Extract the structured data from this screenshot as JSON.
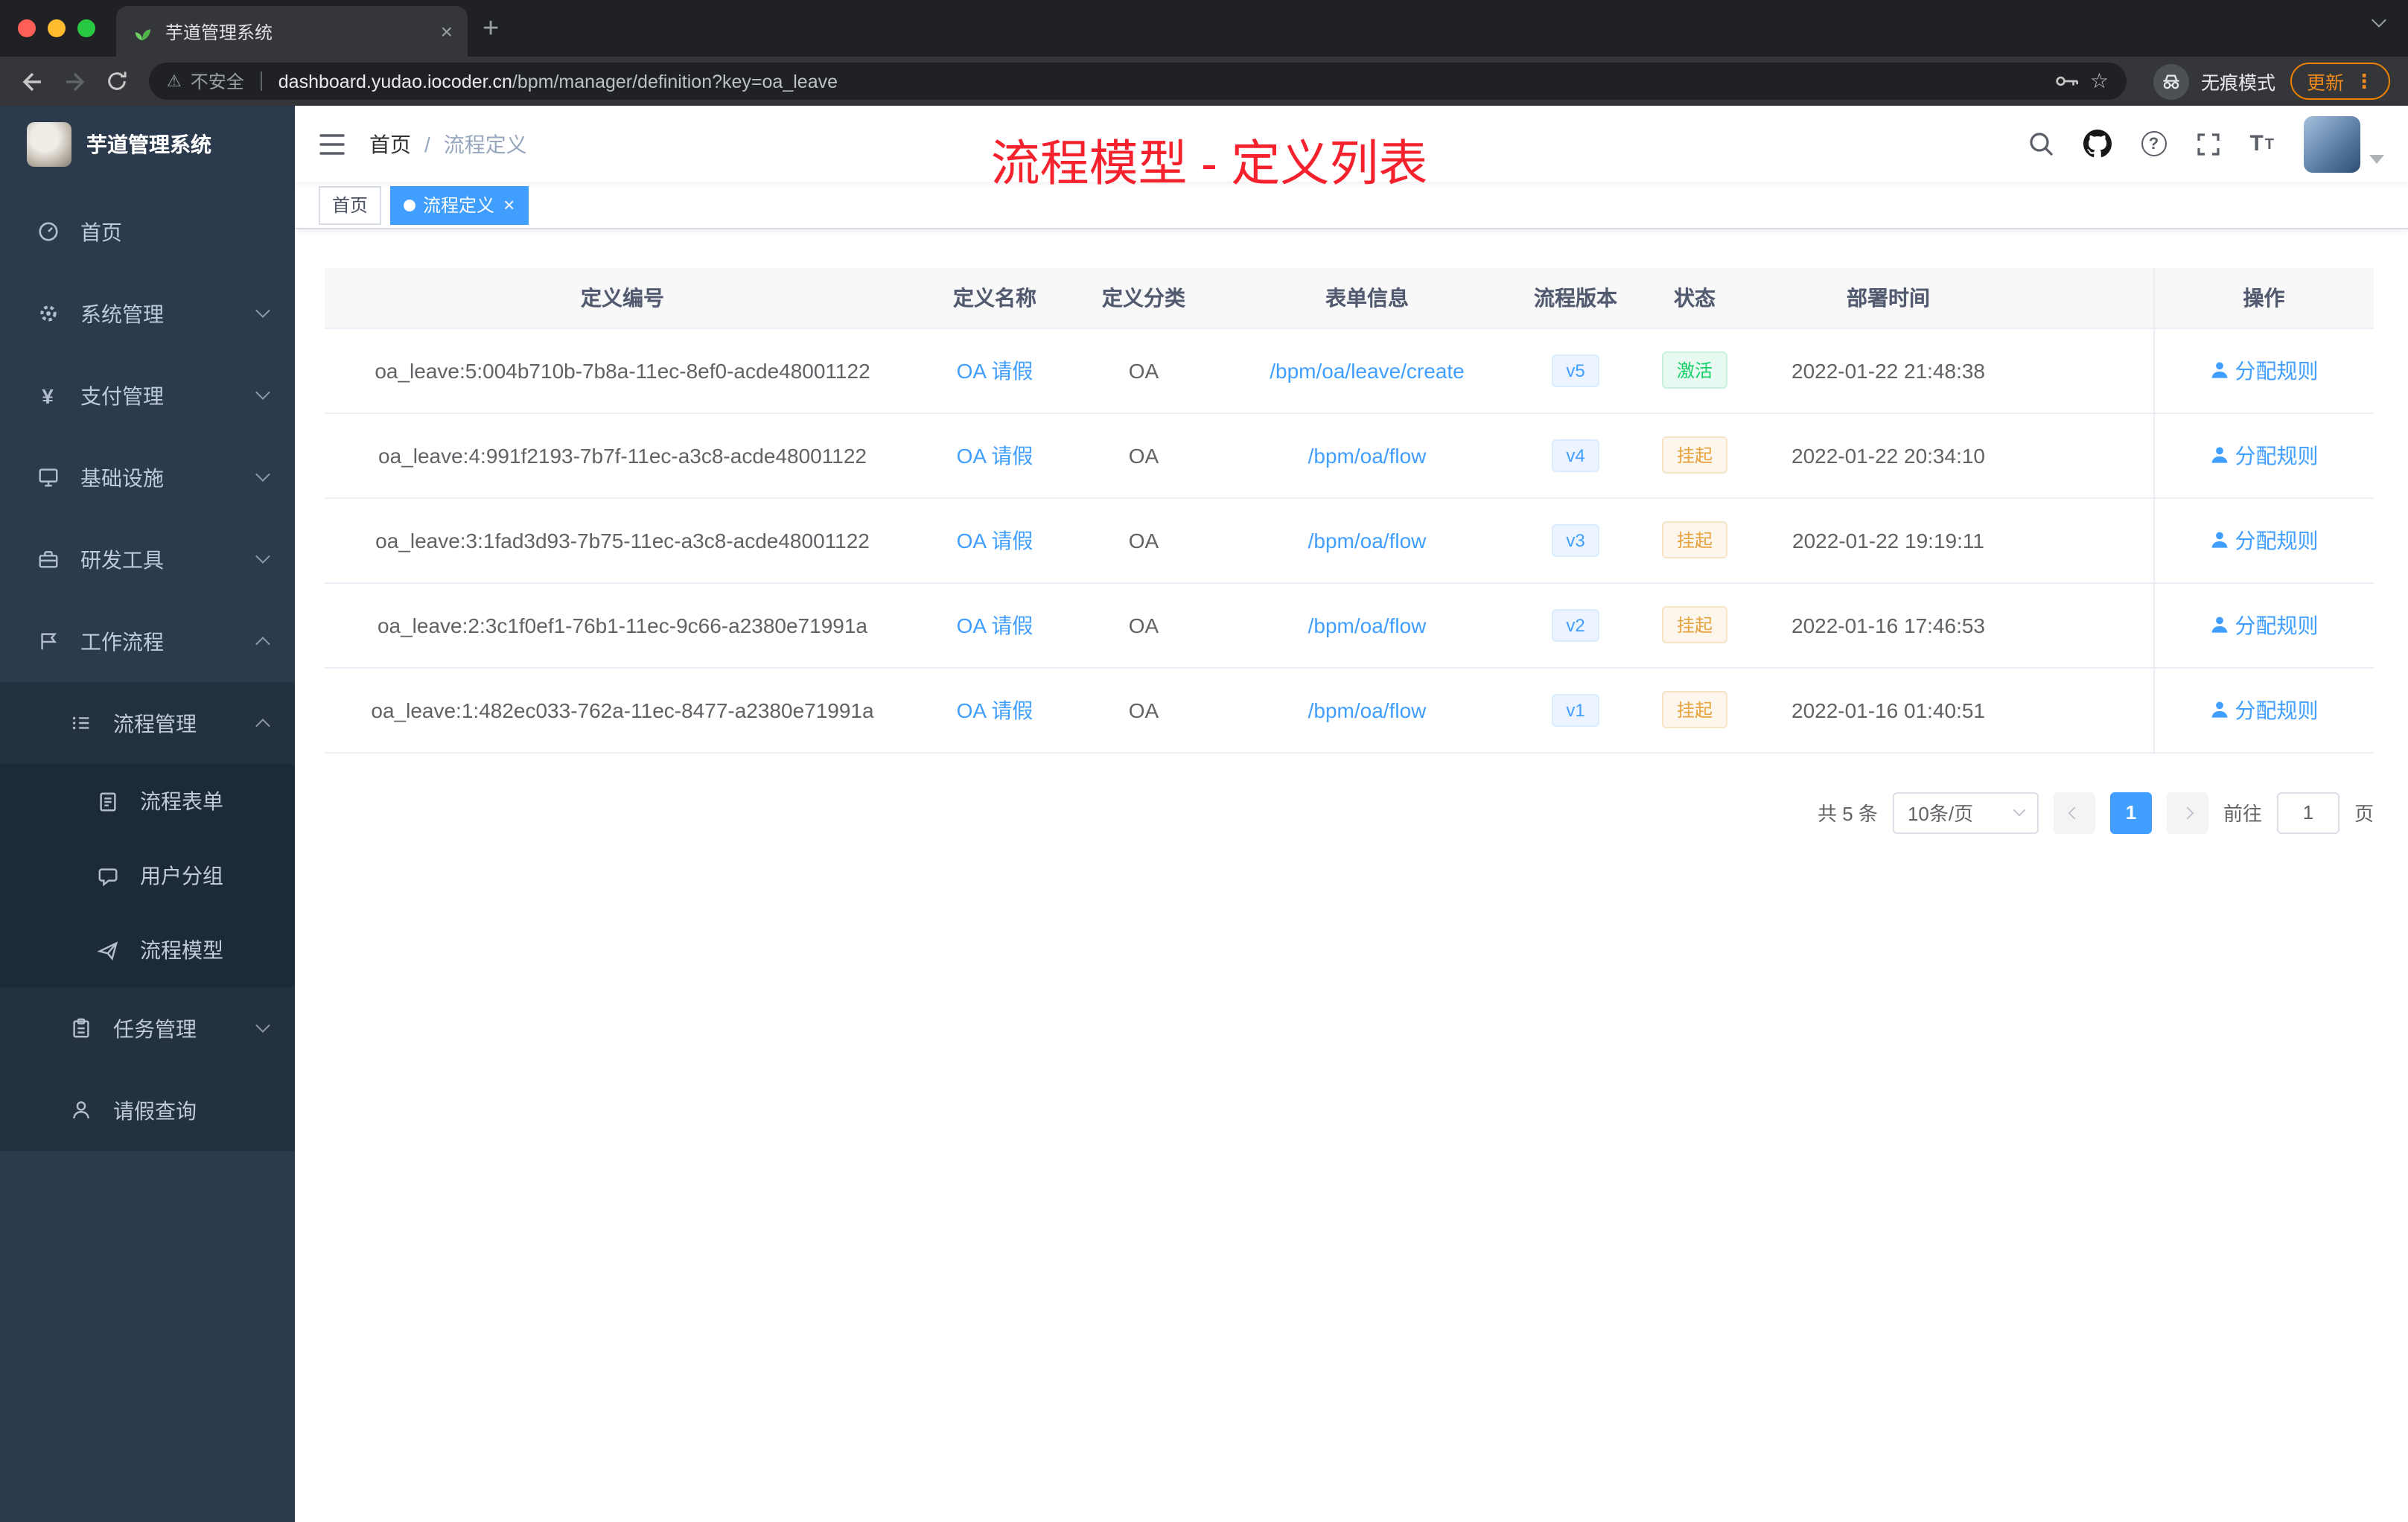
{
  "icons": {
    "close": "×",
    "plus": "+",
    "warning": "⚠",
    "star": "☆",
    "dots": "⋮",
    "yen": "¥",
    "question": "?",
    "font_large": "T",
    "font_small": "T"
  },
  "browser": {
    "tab_title": "芋道管理系统",
    "security_label": "不安全",
    "url_domain": "dashboard.yudao.iocoder.cn",
    "url_path": "/bpm/manager/definition?key=oa_leave",
    "incognito_label": "无痕模式",
    "update_label": "更新"
  },
  "sidebar": {
    "logo_title": "芋道管理系统",
    "items": [
      {
        "label": "首页"
      },
      {
        "label": "系统管理"
      },
      {
        "label": "支付管理"
      },
      {
        "label": "基础设施"
      },
      {
        "label": "研发工具"
      },
      {
        "label": "工作流程"
      },
      {
        "label": "流程管理"
      },
      {
        "label": "流程表单"
      },
      {
        "label": "用户分组"
      },
      {
        "label": "流程模型"
      },
      {
        "label": "任务管理"
      },
      {
        "label": "请假查询"
      }
    ]
  },
  "header": {
    "breadcrumb": {
      "home": "首页",
      "separator": "/",
      "current": "流程定义"
    },
    "annotation": "流程模型 - 定义列表"
  },
  "tags": {
    "home": "首页",
    "active": "流程定义"
  },
  "table": {
    "columns": [
      "定义编号",
      "定义名称",
      "定义分类",
      "表单信息",
      "流程版本",
      "状态",
      "部署时间",
      "操作"
    ],
    "rows": [
      {
        "id": "oa_leave:5:004b710b-7b8a-11ec-8ef0-acde48001122",
        "name": "OA 请假",
        "category": "OA",
        "form": "/bpm/oa/leave/create",
        "version": "v5",
        "status": "激活",
        "status_type": "success",
        "time": "2022-01-22 21:48:38",
        "action": "分配规则"
      },
      {
        "id": "oa_leave:4:991f2193-7b7f-11ec-a3c8-acde48001122",
        "name": "OA 请假",
        "category": "OA",
        "form": "/bpm/oa/flow",
        "version": "v4",
        "status": "挂起",
        "status_type": "warning",
        "time": "2022-01-22 20:34:10",
        "action": "分配规则"
      },
      {
        "id": "oa_leave:3:1fad3d93-7b75-11ec-a3c8-acde48001122",
        "name": "OA 请假",
        "category": "OA",
        "form": "/bpm/oa/flow",
        "version": "v3",
        "status": "挂起",
        "status_type": "warning",
        "time": "2022-01-22 19:19:11",
        "action": "分配规则"
      },
      {
        "id": "oa_leave:2:3c1f0ef1-76b1-11ec-9c66-a2380e71991a",
        "name": "OA 请假",
        "category": "OA",
        "form": "/bpm/oa/flow",
        "version": "v2",
        "status": "挂起",
        "status_type": "warning",
        "time": "2022-01-16 17:46:53",
        "action": "分配规则"
      },
      {
        "id": "oa_leave:1:482ec033-762a-11ec-8477-a2380e71991a",
        "name": "OA 请假",
        "category": "OA",
        "form": "/bpm/oa/flow",
        "version": "v1",
        "status": "挂起",
        "status_type": "warning",
        "time": "2022-01-16 01:40:51",
        "action": "分配规则"
      }
    ]
  },
  "pagination": {
    "total": "共 5 条",
    "page_size": "10条/页",
    "current_page": "1",
    "goto_label": "前往",
    "goto_value": "1",
    "page_unit": "页"
  }
}
